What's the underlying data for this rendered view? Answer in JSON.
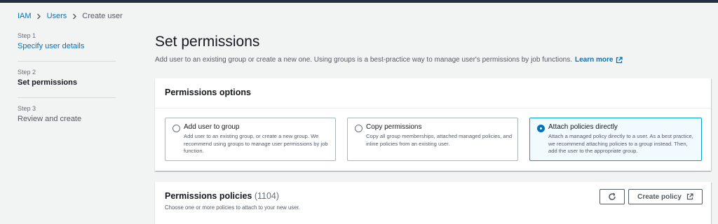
{
  "breadcrumb": {
    "items": [
      "IAM",
      "Users"
    ],
    "current": "Create user"
  },
  "steps": [
    {
      "num": "Step 1",
      "title": "Specify user details"
    },
    {
      "num": "Step 2",
      "title": "Set permissions"
    },
    {
      "num": "Step 3",
      "title": "Review and create"
    }
  ],
  "page": {
    "title": "Set permissions",
    "description": "Add user to an existing group or create a new one. Using groups is a best-practice way to manage user's permissions by job functions.",
    "learn_more": "Learn more"
  },
  "permissions_options": {
    "title": "Permissions options",
    "options": [
      {
        "title": "Add user to group",
        "desc": "Add user to an existing group, or create a new group. We recommend using groups to manage user permissions by job function.",
        "selected": false
      },
      {
        "title": "Copy permissions",
        "desc": "Copy all group memberships, attached managed policies, and inline policies from an existing user.",
        "selected": false
      },
      {
        "title": "Attach policies directly",
        "desc": "Attach a managed policy directly to a user. As a best practice, we recommend attaching policies to a group instead. Then, add the user to the appropriate group.",
        "selected": true
      }
    ]
  },
  "permissions_policies": {
    "title": "Permissions policies",
    "count": "(1104)",
    "subtitle": "Choose one or more policies to attach to your new user.",
    "create_policy_label": "Create policy"
  },
  "icons": {
    "breadcrumb_separator": "chevron-right-icon",
    "learn_more": "external-link-icon",
    "refresh": "refresh-icon",
    "create_policy": "external-link-icon"
  },
  "colors": {
    "link": "#0073bb",
    "selected_border": "#00a1c9",
    "selected_bg": "#f1faff",
    "topbar": "#232f3e"
  }
}
